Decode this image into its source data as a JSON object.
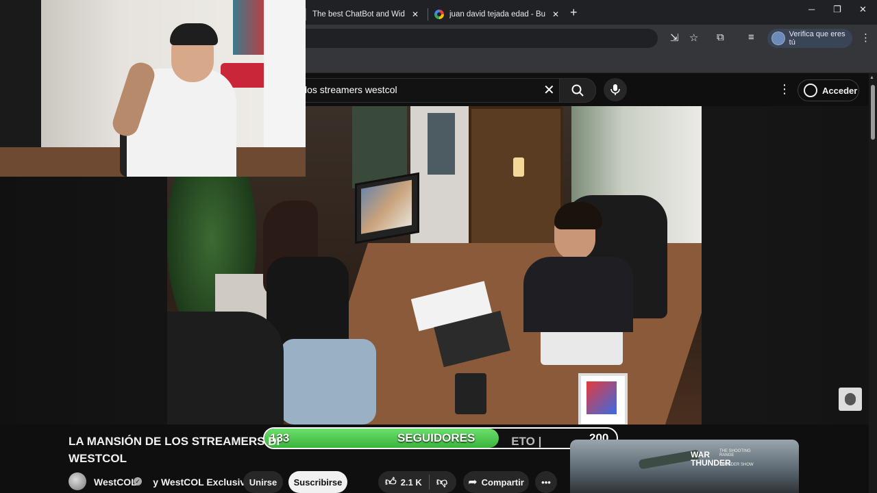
{
  "browser": {
    "tabs": [
      {
        "title": "The best ChatBot and Widgets"
      },
      {
        "title": "juan david tejada edad - Buscar"
      }
    ],
    "verify_label": "Verifica que eres tú"
  },
  "youtube": {
    "search_query": "los streamers westcol",
    "signin_label": "Acceder"
  },
  "overlay": {
    "followers_current": "133",
    "followers_label": "SEGUIDORES",
    "followers_goal": "200",
    "progress": 0.665
  },
  "video": {
    "title_line1": "LA MANSIÓN DE LOS STREAMERS DI",
    "title_line1_tail": "ETO |",
    "title_line2": "WESTCOL",
    "channel": "WestCOL",
    "collab": "y WestCOL Exclusive",
    "join_label": "Unirse",
    "subscribe_label": "Suscribirse",
    "likes": "2.1 K",
    "share_label": "Compartir"
  },
  "ad": {
    "brand": "WAR THUNDER",
    "caption": "THE SHOOTING RANGE",
    "caption2": "THUNDER SHOW"
  },
  "colors": {
    "progress_fill": "#4cc44c",
    "subscribe_bg": "#f1f1f1",
    "chrome_tabstrip": "#202124"
  }
}
